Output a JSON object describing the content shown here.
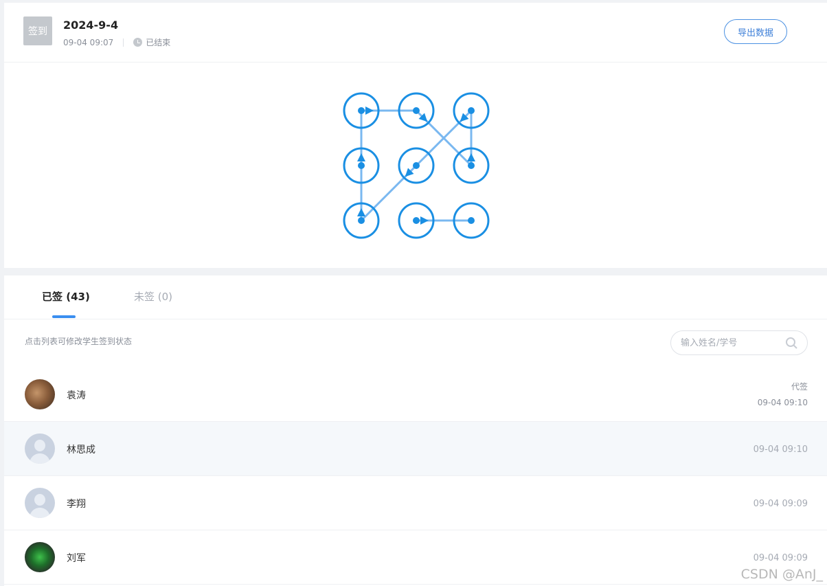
{
  "header": {
    "badge": "签到",
    "title": "2024-9-4",
    "time": "09-04 09:07",
    "status": "已结束",
    "export_label": "导出数据"
  },
  "pattern": {
    "sequence": [
      1,
      2,
      6,
      3,
      5,
      7,
      4,
      1
    ],
    "tail": [
      8,
      9
    ]
  },
  "tabs": [
    {
      "label": "已签 (43)"
    },
    {
      "label": "未签 (0)"
    }
  ],
  "hint": "点击列表可修改学生签到状态",
  "search": {
    "placeholder": "输入姓名/学号"
  },
  "students": [
    {
      "name": "袁涛",
      "tag": "代签",
      "time": "09-04 09:10"
    },
    {
      "name": "林思成",
      "time": "09-04 09:10"
    },
    {
      "name": "李翔",
      "time": "09-04 09:09"
    },
    {
      "name": "刘军",
      "time": "09-04 09:09"
    }
  ],
  "watermark": "CSDN @AnJ_",
  "colors": {
    "accent": "#1a8fe3",
    "line": "#7ab8f0"
  }
}
